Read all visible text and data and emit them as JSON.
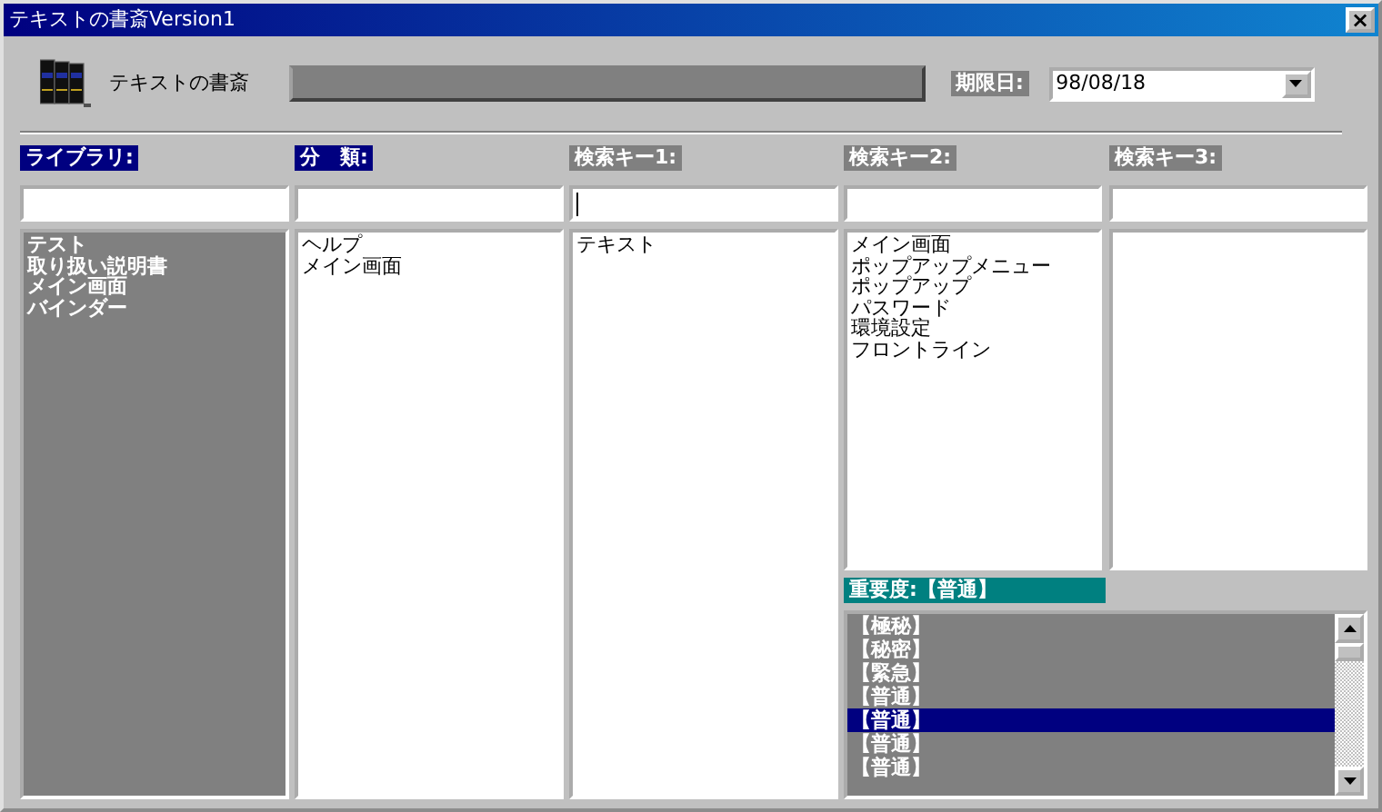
{
  "window": {
    "title": "テキストの書斎Version1",
    "close": "×"
  },
  "header": {
    "app_name": "テキストの書斎",
    "deadline_label": "期限日:",
    "deadline_value": "98/08/18"
  },
  "columns": [
    {
      "label": "ライブラリ:",
      "label_active": true,
      "shaded": true,
      "items": [
        "テスト",
        "取り扱い説明書",
        "メイン画面",
        "バインダー"
      ]
    },
    {
      "label": "分　類:",
      "label_active": true,
      "shaded": false,
      "items": [
        "ヘルプ",
        "メイン画面"
      ]
    },
    {
      "label": "検索キー1:",
      "label_active": false,
      "caret": true,
      "shaded": false,
      "items": [
        "テキスト"
      ]
    },
    {
      "label": "検索キー2:",
      "label_active": false,
      "shaded": false,
      "items": [
        "メイン画面",
        "ポップアップメニュー",
        "ポップアップ",
        "パスワード",
        "環境設定",
        "フロントライン"
      ]
    },
    {
      "label": "検索キー3:",
      "label_active": false,
      "shaded": false
    }
  ],
  "importance": {
    "label": "重要度:【普通】",
    "items": [
      {
        "text": "【極秘】",
        "selected": false
      },
      {
        "text": "【秘密】",
        "selected": false
      },
      {
        "text": "【緊急】",
        "selected": false
      },
      {
        "text": "【普通】",
        "selected": false
      },
      {
        "text": "【普通】",
        "selected": true
      },
      {
        "text": "【普通】",
        "selected": false
      },
      {
        "text": "【普通】",
        "selected": false
      }
    ]
  }
}
